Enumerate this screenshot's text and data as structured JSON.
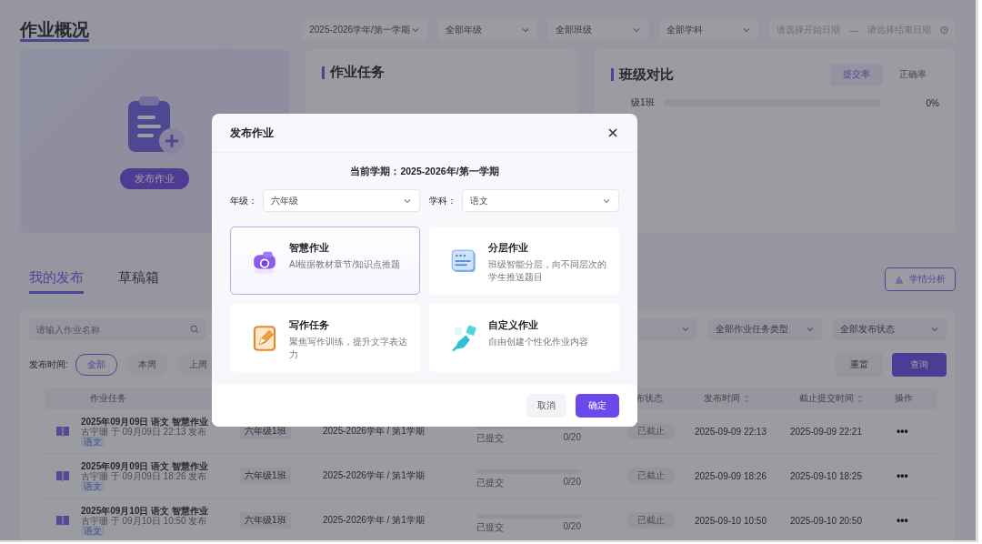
{
  "header": {
    "title": "作业概况",
    "filters": [
      {
        "label": "2025-2026学年/第一学期"
      },
      {
        "label": "全部年级"
      },
      {
        "label": "全部班级"
      },
      {
        "label": "全部学科"
      }
    ],
    "date_range": {
      "start_placeholder": "请选择开始日期",
      "separator": "—",
      "end_placeholder": "请选择结束日期"
    }
  },
  "publish_card": {
    "button": "发布作业"
  },
  "task_card": {
    "title": "作业任务"
  },
  "class_compare": {
    "title": "班级对比",
    "tabs": [
      {
        "label": "提交率",
        "selected": true
      },
      {
        "label": "正确率",
        "selected": false
      }
    ],
    "rows": [
      {
        "name": "级1班",
        "level": 0,
        "value": "0%"
      }
    ]
  },
  "tabs": [
    {
      "label": "我的发布",
      "selected": true
    },
    {
      "label": "草稿箱",
      "selected": false
    }
  ],
  "analysis_button": "学情分析",
  "filters": {
    "search_placeholder": "请输入作业名称",
    "selects": [
      {
        "label": "全部作业任务类型"
      },
      {
        "label": "全部发布状态"
      }
    ],
    "time_label": "发布时间:",
    "time_chips": [
      {
        "label": "全部",
        "selected": true
      },
      {
        "label": "本周",
        "selected": false
      },
      {
        "label": "上周",
        "selected": false
      }
    ],
    "reset": "重置",
    "query": "查询"
  },
  "table": {
    "columns": [
      {
        "label": "作业任务",
        "sortable": false
      },
      {
        "label": "布状态",
        "sortable": false
      },
      {
        "label": "发布时间",
        "sortable": true
      },
      {
        "label": "截止提交时间",
        "sortable": true
      },
      {
        "label": "操作",
        "sortable": false
      }
    ],
    "rows": [
      {
        "title": "2025年09月09日 语文 智慧作业",
        "meta": "古宇珊 于 09月09日 22:13 发布",
        "tag": "语文",
        "class": "六年级1班",
        "term": "2025-2026学年 / 第1学期",
        "progress_label": "已提交",
        "level": 0,
        "count": "0/20",
        "status": "已截止",
        "published": "2025-09-09 22:13",
        "deadline": "2025-09-09 22:21",
        "actions": "•••"
      },
      {
        "title": "2025年09月09日 语文 智慧作业",
        "meta": "古宇珊 于 09月09日 18:26 发布",
        "tag": "语文",
        "class": "六年级1班",
        "term": "2025-2026学年 / 第1学期",
        "progress_label": "已提交",
        "level": 0,
        "count": "0/20",
        "status": "已截止",
        "published": "2025-09-09 18:26",
        "deadline": "2025-09-10 18:25",
        "actions": "•••"
      },
      {
        "title": "2025年09月10日 语文 智慧作业",
        "meta": "古宇珊 于 09月10日 10:50 发布",
        "tag": "语文",
        "class": "六年级1班",
        "term": "2025-2026学年 / 第1学期",
        "progress_label": "已提交",
        "level": 0,
        "count": "0/20",
        "status": "已截止",
        "published": "2025-09-10 10:50",
        "deadline": "2025-09-10 20:50",
        "actions": "•••"
      }
    ]
  },
  "dialog": {
    "title": "发布作业",
    "term": "当前学期：2025-2026年/第一学期",
    "fields": [
      {
        "label": "年级：",
        "value": "六年级"
      },
      {
        "label": "学科：",
        "value": "语文"
      }
    ],
    "types": [
      {
        "kind": "smart",
        "title": "智慧作业",
        "desc": "AI根据教材章节/知识点推题",
        "selected": true
      },
      {
        "kind": "layered",
        "title": "分层作业",
        "desc": "班级智能分层，向不同层次的学生推送题目",
        "selected": false
      },
      {
        "kind": "writing",
        "title": "写作任务",
        "desc": "聚焦写作训练，提升文字表达力",
        "selected": false
      },
      {
        "kind": "custom",
        "title": "自定义作业",
        "desc": "自由创建个性化作业内容",
        "selected": false
      }
    ],
    "buttons": [
      {
        "label": "取消",
        "kind": "secondary"
      },
      {
        "label": "确定",
        "kind": "primary"
      }
    ]
  }
}
